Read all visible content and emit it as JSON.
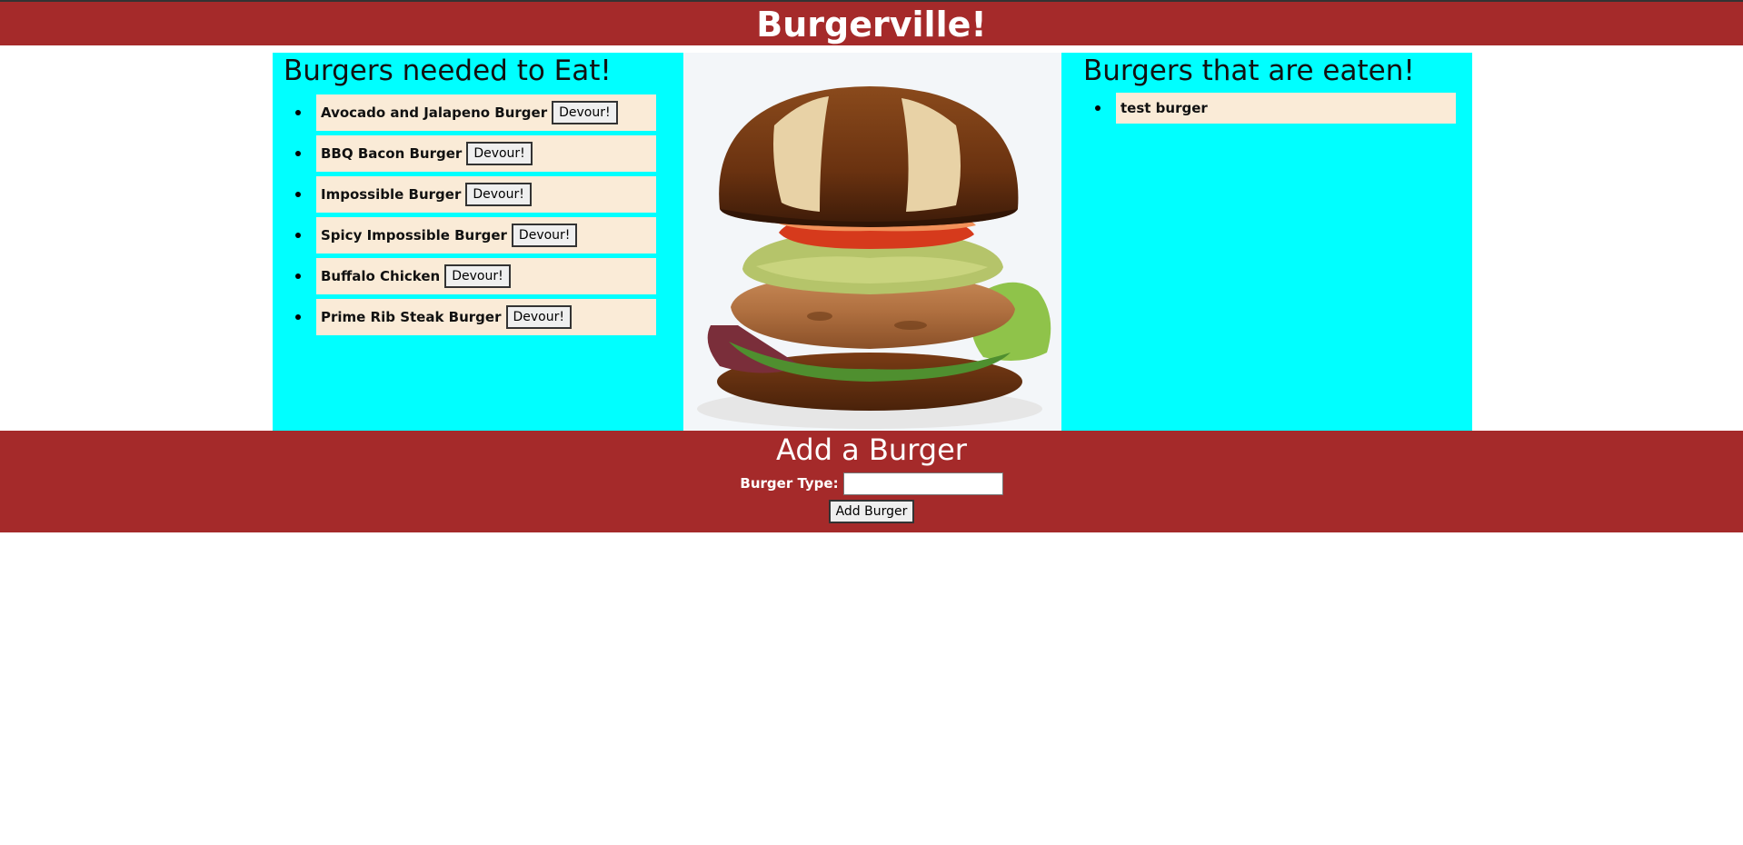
{
  "header": {
    "title": "Burgerville!"
  },
  "uneaten": {
    "heading": "Burgers needed to Eat!",
    "button_label": "Devour!",
    "items": [
      {
        "name": "Avocado and Jalapeno Burger"
      },
      {
        "name": "BBQ Bacon Burger"
      },
      {
        "name": "Impossible Burger"
      },
      {
        "name": "Spicy Impossible Burger"
      },
      {
        "name": "Buffalo Chicken"
      },
      {
        "name": "Prime Rib Steak Burger"
      }
    ]
  },
  "eaten": {
    "heading": "Burgers that are eaten!",
    "items": [
      {
        "name": "test burger"
      }
    ]
  },
  "add_form": {
    "heading": "Add a Burger",
    "label": "Burger Type:",
    "input_value": "",
    "submit_label": "Add Burger"
  },
  "colors": {
    "header_bg": "#a52a2a",
    "panel_bg": "#00ffff",
    "item_bg": "#faebd7"
  }
}
